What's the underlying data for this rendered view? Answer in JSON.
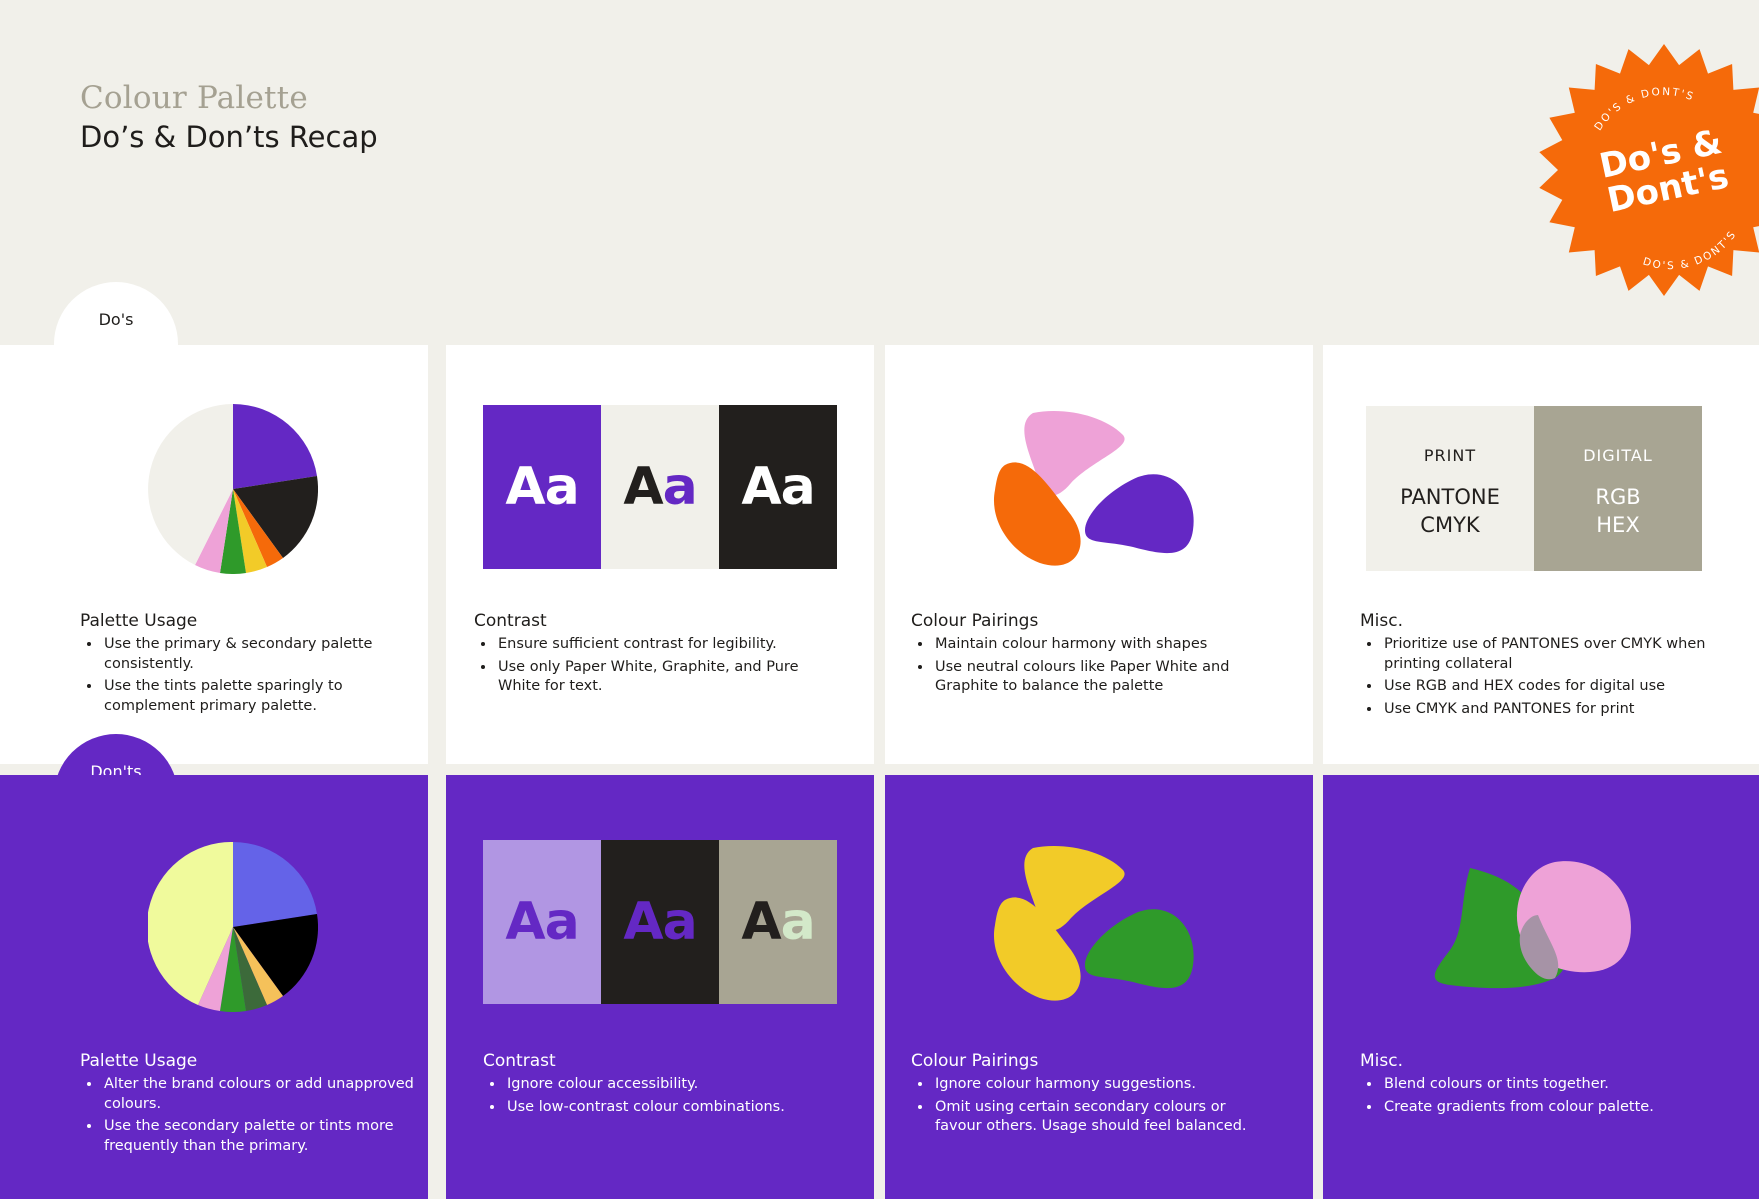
{
  "header": {
    "subtitle": "Colour Palette",
    "title": "Do’s & Don’ts Recap"
  },
  "badge": {
    "main_line1": "Do's &",
    "main_line2": "Dont's",
    "ring_text": "DO'S & DONT'S",
    "color": "#f56a0a"
  },
  "tabs": {
    "dos": "Do's",
    "donts": "Don'ts"
  },
  "colors": {
    "purple": "#6428c4",
    "paper_white": "#f1f0ea",
    "graphite": "#221f1d",
    "orange": "#f56a0a",
    "pink": "#eea2d7",
    "yellow": "#f2cb28",
    "green": "#2f9a2a",
    "taupe": "#a8a593"
  },
  "dos": {
    "palette_usage": {
      "title": "Palette Usage",
      "bullets": [
        "Use the primary & secondary palette consistently.",
        "Use the tints palette sparingly to complement primary palette."
      ]
    },
    "contrast": {
      "title": "Contrast",
      "bullets": [
        "Ensure sufficient contrast for legibility.",
        "Use only Paper White, Graphite, and Pure White for text."
      ],
      "swatch_text": [
        "Aa",
        "A",
        "a",
        "Aa"
      ]
    },
    "pairings": {
      "title": "Colour Pairings",
      "bullets": [
        "Maintain colour harmony with shapes",
        "Use neutral colours like Paper White and Graphite to balance the palette"
      ]
    },
    "misc": {
      "title": "Misc.",
      "bullets": [
        "Prioritize use of PANTONES over CMYK when printing collateral",
        "Use RGB and HEX codes for digital use",
        "Use CMYK and PANTONES for print"
      ],
      "print_label": "PRINT",
      "print_line1": "PANTONE",
      "print_line2": "CMYK",
      "digital_label": "DIGITAL",
      "digital_line1": "RGB",
      "digital_line2": "HEX"
    }
  },
  "donts": {
    "palette_usage": {
      "title": "Palette Usage",
      "bullets": [
        "Alter the brand colours or add unapproved colours.",
        "Use the secondary palette or tints more frequently than the primary."
      ]
    },
    "contrast": {
      "title": "Contrast",
      "bullets": [
        "Ignore colour accessibility.",
        "Use low-contrast colour combinations."
      ],
      "swatch_text": [
        "Aa",
        "Aa",
        "A",
        "a"
      ]
    },
    "pairings": {
      "title": "Colour Pairings",
      "bullets": [
        "Ignore colour harmony suggestions.",
        "Omit using certain secondary colours or favour others. Usage should feel balanced."
      ]
    },
    "misc": {
      "title": "Misc.",
      "bullets": [
        "Blend colours or tints together.",
        "Create gradients from colour palette."
      ]
    }
  }
}
